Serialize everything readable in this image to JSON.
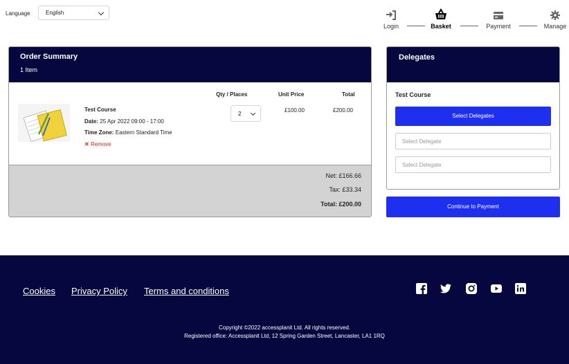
{
  "language": {
    "label": "Language",
    "value": "English"
  },
  "steps": [
    {
      "label": "Login",
      "icon": "login-icon"
    },
    {
      "label": "Basket",
      "icon": "basket-icon"
    },
    {
      "label": "Payment",
      "icon": "payment-card-icon"
    },
    {
      "label": "Manage",
      "icon": "gear-icon"
    }
  ],
  "order": {
    "title": "Order Summary",
    "count": "1 Item",
    "headers": {
      "qty": "Qty / Places",
      "unit": "Unit Price",
      "total": "Total"
    },
    "item": {
      "name": "Test Course",
      "date_label": "Date:",
      "date": "25 Apr 2022 09:00 - 17:00",
      "tz_label": "Time Zone:",
      "tz": "Eastern Standard Time",
      "remove": "Remove",
      "qty": "2",
      "unit_price": "£100.00",
      "total": "£200.00"
    },
    "net": "Net: £166.66",
    "tax": "Tax: £33.34",
    "grand_total": "Total: £200.00"
  },
  "delegates": {
    "title": "Delegates",
    "course": "Test Course",
    "select_button": "Select Delegates",
    "placeholder": "Select Delegate",
    "continue_button": "Continue to Payment"
  },
  "footer": {
    "links": [
      "Cookies",
      "Privacy Policy",
      "Terms and conditions"
    ],
    "social": [
      "facebook-icon",
      "twitter-icon",
      "instagram-icon",
      "youtube-icon",
      "linkedin-icon"
    ],
    "copyright": "Copyright ©2022 accessplanit Ltd. All rights reserved.",
    "office": "Registered office: Accessplanit Ltd, 12 Spring Garden Street, Lancaster, LA1 1RQ"
  },
  "colors": {
    "navy": "#07073f",
    "button_blue": "#1f2ff0",
    "remove_red": "#d21"
  }
}
